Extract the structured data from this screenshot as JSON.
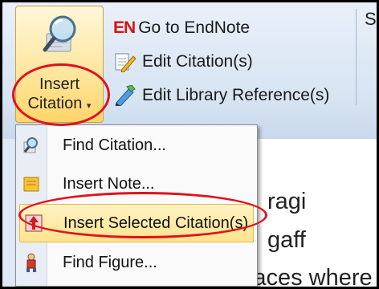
{
  "ribbon": {
    "insert_citation": {
      "line1": "Insert",
      "line2": "Citation",
      "caret": "▾"
    },
    "commands": [
      {
        "badge": "EN",
        "label": "Go to EndNote",
        "icon": "endnote-logo-icon"
      },
      {
        "label": "Edit Citation(s)",
        "icon": "edit-citation-icon"
      },
      {
        "label": "Edit Library Reference(s)",
        "icon": "edit-library-icon"
      }
    ],
    "next_group_partial": "S"
  },
  "menu": {
    "items": [
      {
        "label": "Find Citation...",
        "mnemonic": "C",
        "icon": "find-citation-icon"
      },
      {
        "label": "Insert Note...",
        "mnemonic": "N",
        "icon": "insert-note-icon"
      },
      {
        "label": "Insert Selected Citation(s)",
        "mnemonic": "S",
        "icon": "insert-selected-citation-icon",
        "highlighted": true
      },
      {
        "label": "Find Figure...",
        "mnemonic": "F",
        "icon": "find-figure-icon"
      }
    ]
  },
  "document": {
    "lines": [
      "ragi",
      "gaff",
      "surfaces where"
    ]
  },
  "colors": {
    "annotation_ring": "#e0121b",
    "highlight": "#ffe38e",
    "en_badge": "#d41414"
  }
}
